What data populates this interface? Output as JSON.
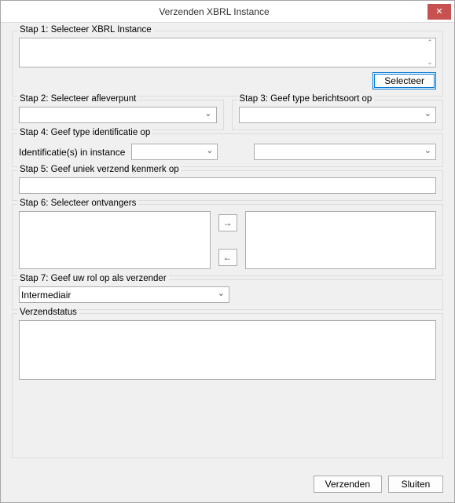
{
  "window": {
    "title": "Verzenden XBRL Instance",
    "close_label": "✕"
  },
  "step1": {
    "title": "Stap 1: Selecteer XBRL Instance",
    "value": "",
    "select_button": "Selecteer"
  },
  "step2": {
    "title": "Stap 2: Selecteer afleverpunt",
    "value": ""
  },
  "step3": {
    "title": "Stap 3: Geef type berichtsoort op",
    "value": ""
  },
  "step4": {
    "title": "Stap 4: Geef type identificatie op",
    "label": "Identificatie(s) in instance",
    "value_a": "",
    "value_b": ""
  },
  "step5": {
    "title": "Stap 5: Geef uniek verzend kenmerk op",
    "value": ""
  },
  "step6": {
    "title": "Stap 6: Selecteer ontvangers",
    "arrow_right": "→",
    "arrow_left": "←"
  },
  "step7": {
    "title": "Stap 7: Geef uw rol op als verzender",
    "value": "Intermediair"
  },
  "status": {
    "title": "Verzendstatus",
    "value": ""
  },
  "footer": {
    "send": "Verzenden",
    "close": "Sluiten"
  }
}
